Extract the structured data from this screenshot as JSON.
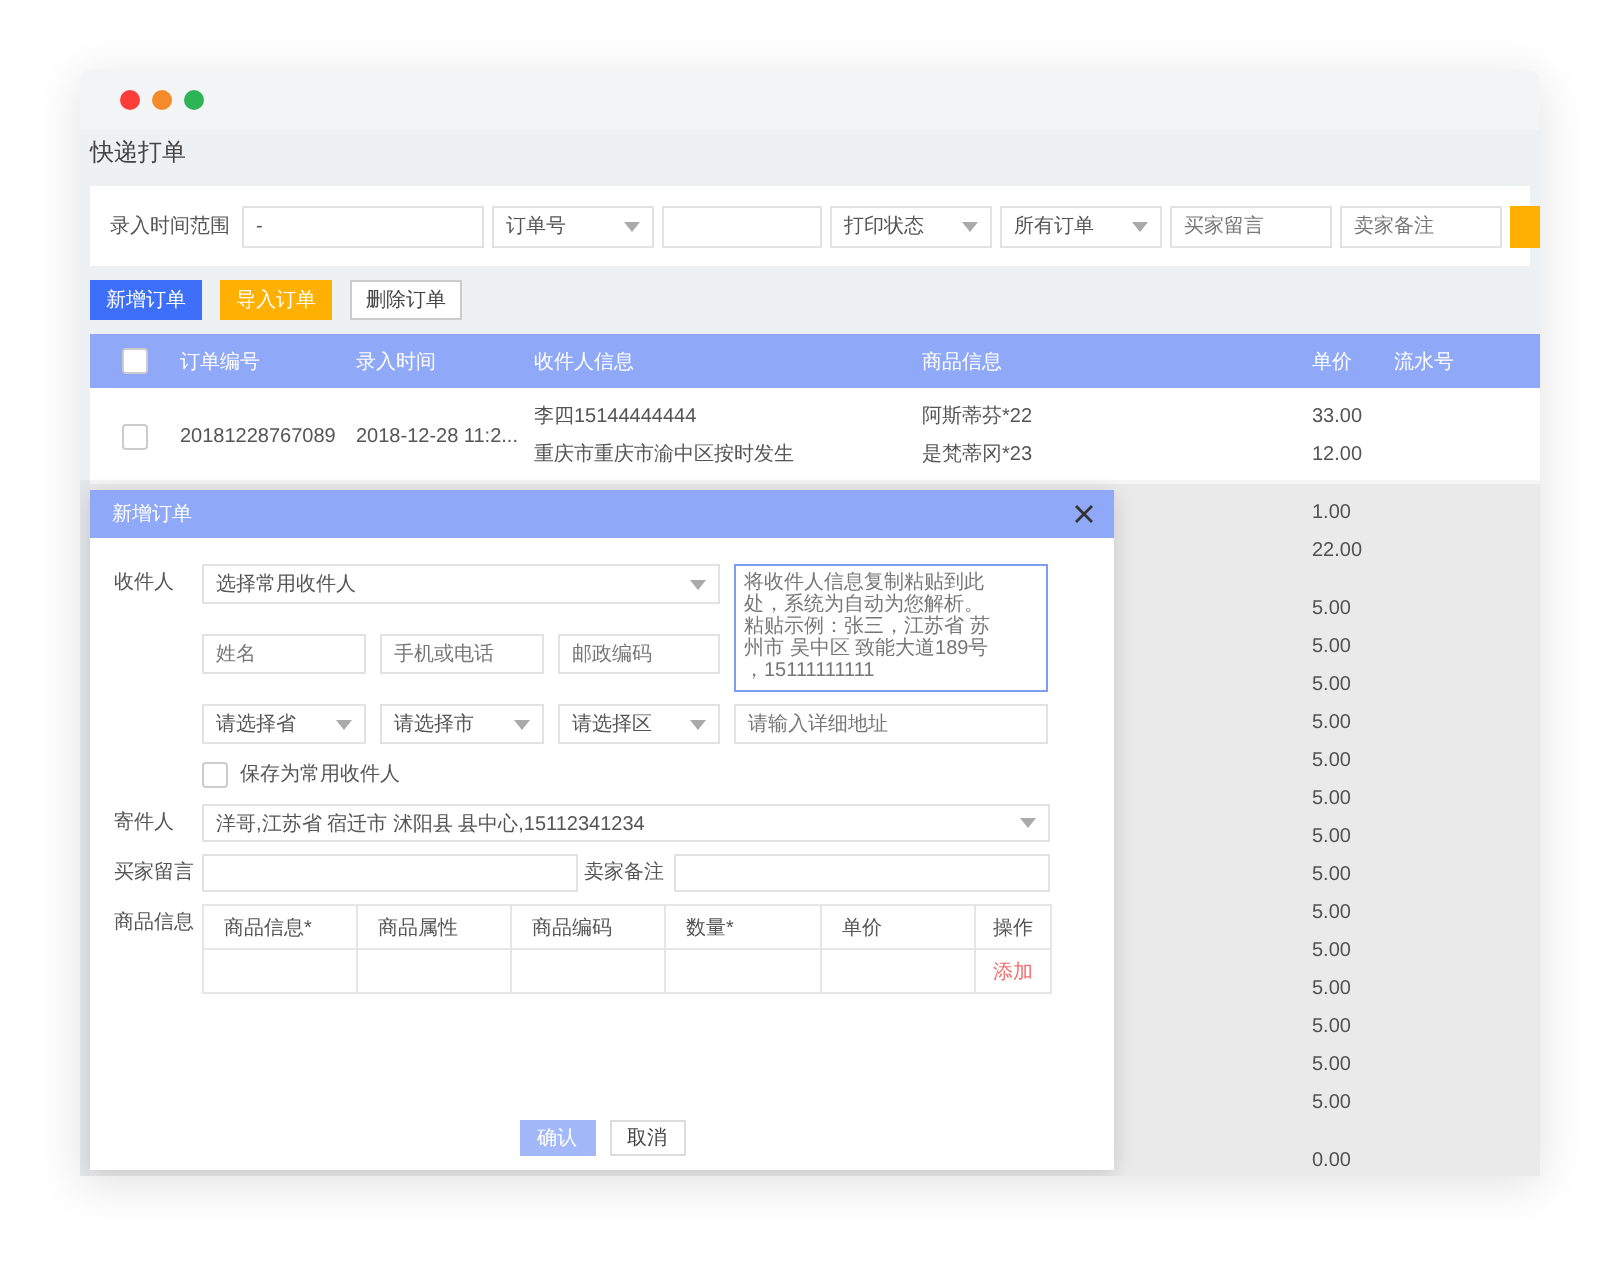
{
  "page_title": "快递打单",
  "filters": [
    {
      "kind": "label",
      "text": "录入时间范围"
    },
    {
      "kind": "input",
      "value": "-"
    },
    {
      "kind": "select",
      "value": "订单号"
    },
    {
      "kind": "input"
    },
    {
      "kind": "select",
      "value": "打印状态"
    },
    {
      "kind": "select",
      "value": "所有订单"
    },
    {
      "kind": "input",
      "placeholder": "买家留言"
    },
    {
      "kind": "input",
      "placeholder": "卖家备注"
    },
    {
      "kind": "button"
    }
  ],
  "toolbar": [
    {
      "label": "新增订单",
      "kind": "primary"
    },
    {
      "label": "导入订单",
      "kind": "warning"
    },
    {
      "label": "删除订单",
      "kind": "plain"
    }
  ],
  "table": {
    "header_checked": false,
    "columns": [
      "订单编号",
      "录入时间",
      "收件人信息",
      "商品信息",
      "单价",
      "流水号"
    ],
    "rows": [
      {
        "checked": false,
        "order_no": "20181228767089",
        "time": "2018-12-28 11:2...",
        "recipient": [
          "李四15144444444",
          "重庆市重庆市渝中区按时发生"
        ],
        "goods": [
          "阿斯蒂芬*22",
          "是梵蒂冈*23"
        ],
        "prices": [
          "33.00",
          "12.00"
        ]
      },
      {
        "prices": [
          "1.00",
          "22.00"
        ]
      },
      {
        "prices": [
          "5.00",
          "5.00",
          "5.00",
          "5.00",
          "5.00",
          "5.00",
          "5.00",
          "5.00",
          "5.00",
          "5.00",
          "5.00",
          "5.00",
          "5.00",
          "5.00"
        ]
      },
      {
        "prices": [
          "0.00"
        ]
      }
    ]
  },
  "modal": {
    "title": "新增订单",
    "recipient": {
      "label": "收件人",
      "contact_select": "选择常用收件人",
      "paste_placeholder": "将收件人信息复制粘贴到此处，系统为自动为您解析。粘贴示例：张三，江苏省 苏州市 吴中区 致能大道189号，15111111111",
      "name_placeholder": "姓名",
      "phone_placeholder": "手机或电话",
      "postcode_placeholder": "邮政编码",
      "province_select": "请选择省",
      "city_select": "请选择市",
      "district_select": "请选择区",
      "address_placeholder": "请输入详细地址",
      "save_contact": {
        "label": "保存为常用收件人",
        "checked": false
      }
    },
    "sender": {
      "label": "寄件人",
      "value": "洋哥,江苏省 宿迁市 沭阳县 县中心,15112341234"
    },
    "buyer_note_label": "买家留言",
    "seller_note_label": "卖家备注",
    "goods": {
      "label": "商品信息",
      "columns": [
        "商品信息*",
        "商品属性",
        "商品编码",
        "数量*",
        "单价",
        "操作"
      ],
      "add_link": "添加"
    },
    "buttons": [
      {
        "label": "确认",
        "kind": "primary"
      },
      {
        "label": "取消",
        "kind": "plain"
      }
    ]
  }
}
